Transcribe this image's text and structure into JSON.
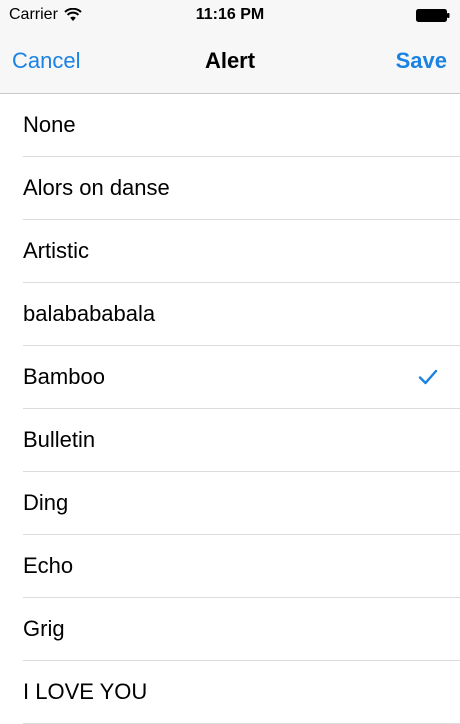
{
  "status_bar": {
    "carrier": "Carrier",
    "time": "11:16 PM",
    "wifi_icon": "wifi-icon",
    "battery_icon": "battery-full-icon"
  },
  "nav": {
    "cancel_label": "Cancel",
    "title": "Alert",
    "save_label": "Save"
  },
  "tones": {
    "items": [
      {
        "label": "None",
        "selected": false
      },
      {
        "label": "Alors on danse",
        "selected": false
      },
      {
        "label": "Artistic",
        "selected": false
      },
      {
        "label": "balabababala",
        "selected": false
      },
      {
        "label": "Bamboo",
        "selected": true
      },
      {
        "label": "Bulletin",
        "selected": false
      },
      {
        "label": "Ding",
        "selected": false
      },
      {
        "label": "Echo",
        "selected": false
      },
      {
        "label": "Grig",
        "selected": false
      },
      {
        "label": "I LOVE YOU",
        "selected": false
      }
    ],
    "selected_icon": "checkmark-icon"
  },
  "colors": {
    "accent": "#1a82e2",
    "nav_background": "#f7f7f8",
    "separator": "#dcdce0"
  }
}
